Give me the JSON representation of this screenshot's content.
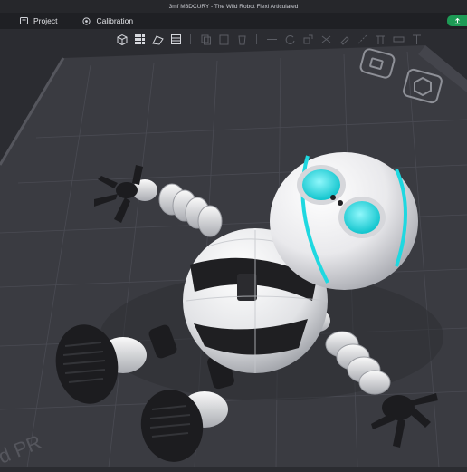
{
  "window": {
    "title": "3mf M3DCURY - The Wild Robot Flexi Articulated"
  },
  "menu": {
    "project_label": "Project",
    "calibration_label": "Calibration"
  },
  "toolbar": {
    "tools": [
      "add-object-icon",
      "grid-arrange-icon",
      "orient-icon",
      "layers-icon",
      "copy-icon",
      "paste-icon",
      "delete-icon",
      "move-icon",
      "rotate-icon",
      "scale-icon",
      "cut-icon",
      "paint-icon",
      "seam-icon",
      "support-icon",
      "measure-icon",
      "text-icon"
    ]
  },
  "colors": {
    "bed": "#3b3c42",
    "grid": "#4a4b52",
    "accent_teal": "#1fd8e0",
    "sync_green": "#1d9a55"
  }
}
